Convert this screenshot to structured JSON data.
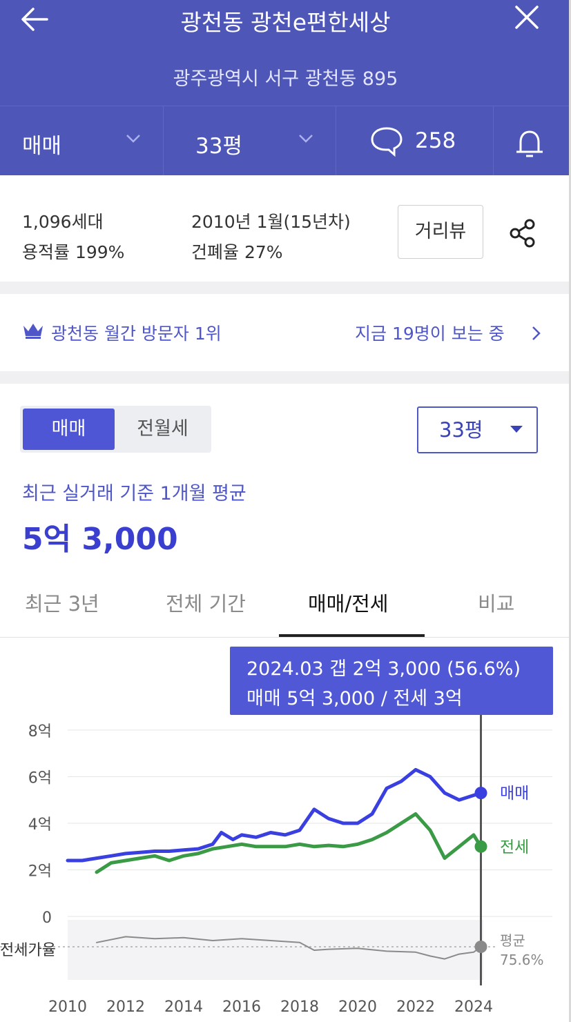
{
  "header": {
    "title": "광천동 광천e편한세상",
    "address": "광주광역시 서구 광천동 895",
    "trade_type": "매매",
    "size": "33평",
    "comment_count": "258"
  },
  "info": {
    "households": "1,096세대",
    "floor_area_ratio": "용적률 199%",
    "built": "2010년 1월(15년차)",
    "coverage_ratio": "건폐율 27%",
    "street_view_label": "거리뷰"
  },
  "rank": {
    "label": "광천동 월간 방문자 1위",
    "viewers": "지금 19명이 보는 중"
  },
  "price_panel": {
    "seg_sale": "매매",
    "seg_rent": "전월세",
    "size_select": "33평",
    "basis": "최근 실거래 기준 1개월 평균",
    "price": "5억 3,000"
  },
  "tabs": [
    {
      "label": "최근 3년"
    },
    {
      "label": "전체 기간"
    },
    {
      "label": "매매/전세"
    },
    {
      "label": "비교"
    }
  ],
  "tooltip": {
    "line1": "2024.03  갭 2억 3,000 (56.6%)",
    "line2": "매매 5억 3,000 / 전세 3억"
  },
  "icons": [
    "back-arrow-icon",
    "close-icon",
    "chevron-down-icon",
    "comment-icon",
    "bell-icon",
    "share-icon",
    "crown-icon",
    "chevron-right-icon",
    "dropdown-triangle-icon"
  ],
  "colors": {
    "brand": "#4e56b8",
    "sale_line": "#3a3fe0",
    "jeonse_line": "#3a9a45",
    "ratio_line": "#8a8a8a"
  },
  "chart_data": {
    "type": "line",
    "x_ticks": [
      "2010",
      "2012",
      "2014",
      "2016",
      "2018",
      "2020",
      "2022",
      "2024"
    ],
    "y_ticks": [
      "8억",
      "6억",
      "4억",
      "2억",
      "0"
    ],
    "ylim": [
      0,
      8
    ],
    "xlim": [
      2010,
      2024.5
    ],
    "grid": true,
    "series": [
      {
        "name": "매매",
        "color": "#3a3fe0",
        "points": [
          [
            2010.0,
            2.4
          ],
          [
            2010.5,
            2.4
          ],
          [
            2011.0,
            2.5
          ],
          [
            2011.5,
            2.6
          ],
          [
            2012.0,
            2.7
          ],
          [
            2012.5,
            2.75
          ],
          [
            2013.0,
            2.8
          ],
          [
            2013.5,
            2.8
          ],
          [
            2014.0,
            2.85
          ],
          [
            2014.5,
            2.9
          ],
          [
            2015.0,
            3.1
          ],
          [
            2015.3,
            3.6
          ],
          [
            2015.7,
            3.3
          ],
          [
            2016.0,
            3.5
          ],
          [
            2016.5,
            3.4
          ],
          [
            2017.0,
            3.6
          ],
          [
            2017.5,
            3.5
          ],
          [
            2018.0,
            3.7
          ],
          [
            2018.5,
            4.6
          ],
          [
            2019.0,
            4.2
          ],
          [
            2019.5,
            4.0
          ],
          [
            2020.0,
            4.0
          ],
          [
            2020.5,
            4.4
          ],
          [
            2021.0,
            5.5
          ],
          [
            2021.5,
            5.8
          ],
          [
            2022.0,
            6.3
          ],
          [
            2022.5,
            6.0
          ],
          [
            2023.0,
            5.3
          ],
          [
            2023.5,
            5.0
          ],
          [
            2024.0,
            5.2
          ],
          [
            2024.25,
            5.3
          ]
        ]
      },
      {
        "name": "전세",
        "color": "#3a9a45",
        "points": [
          [
            2011.0,
            1.9
          ],
          [
            2011.5,
            2.3
          ],
          [
            2012.0,
            2.4
          ],
          [
            2012.5,
            2.5
          ],
          [
            2013.0,
            2.6
          ],
          [
            2013.5,
            2.4
          ],
          [
            2014.0,
            2.6
          ],
          [
            2014.5,
            2.7
          ],
          [
            2015.0,
            2.9
          ],
          [
            2015.5,
            3.0
          ],
          [
            2016.0,
            3.1
          ],
          [
            2016.5,
            3.0
          ],
          [
            2017.0,
            3.0
          ],
          [
            2017.5,
            3.0
          ],
          [
            2018.0,
            3.1
          ],
          [
            2018.5,
            3.0
          ],
          [
            2019.0,
            3.05
          ],
          [
            2019.5,
            3.0
          ],
          [
            2020.0,
            3.1
          ],
          [
            2020.5,
            3.3
          ],
          [
            2021.0,
            3.6
          ],
          [
            2021.5,
            4.0
          ],
          [
            2022.0,
            4.4
          ],
          [
            2022.5,
            3.7
          ],
          [
            2023.0,
            2.5
          ],
          [
            2023.5,
            3.0
          ],
          [
            2024.0,
            3.5
          ],
          [
            2024.25,
            3.0
          ]
        ]
      },
      {
        "name": "전세가율",
        "color": "#8a8a8a",
        "points": [
          [
            2011.0,
            80
          ],
          [
            2012.0,
            86
          ],
          [
            2013.0,
            84
          ],
          [
            2014.0,
            85
          ],
          [
            2015.0,
            82
          ],
          [
            2016.0,
            84
          ],
          [
            2017.0,
            82
          ],
          [
            2018.0,
            80
          ],
          [
            2018.5,
            72
          ],
          [
            2019.0,
            73
          ],
          [
            2020.0,
            74
          ],
          [
            2021.0,
            71
          ],
          [
            2022.0,
            70
          ],
          [
            2022.5,
            66
          ],
          [
            2023.0,
            63
          ],
          [
            2023.5,
            68
          ],
          [
            2024.0,
            70
          ],
          [
            2024.25,
            75.6
          ]
        ]
      }
    ],
    "end_labels": {
      "sale": "매매",
      "jeonse": "전세"
    },
    "ratio_label": "전세가율",
    "ratio_avg_label": "평균",
    "ratio_avg_value": "75.6%",
    "ratio_avg": 75.6,
    "cursor_x": 2024.25
  }
}
